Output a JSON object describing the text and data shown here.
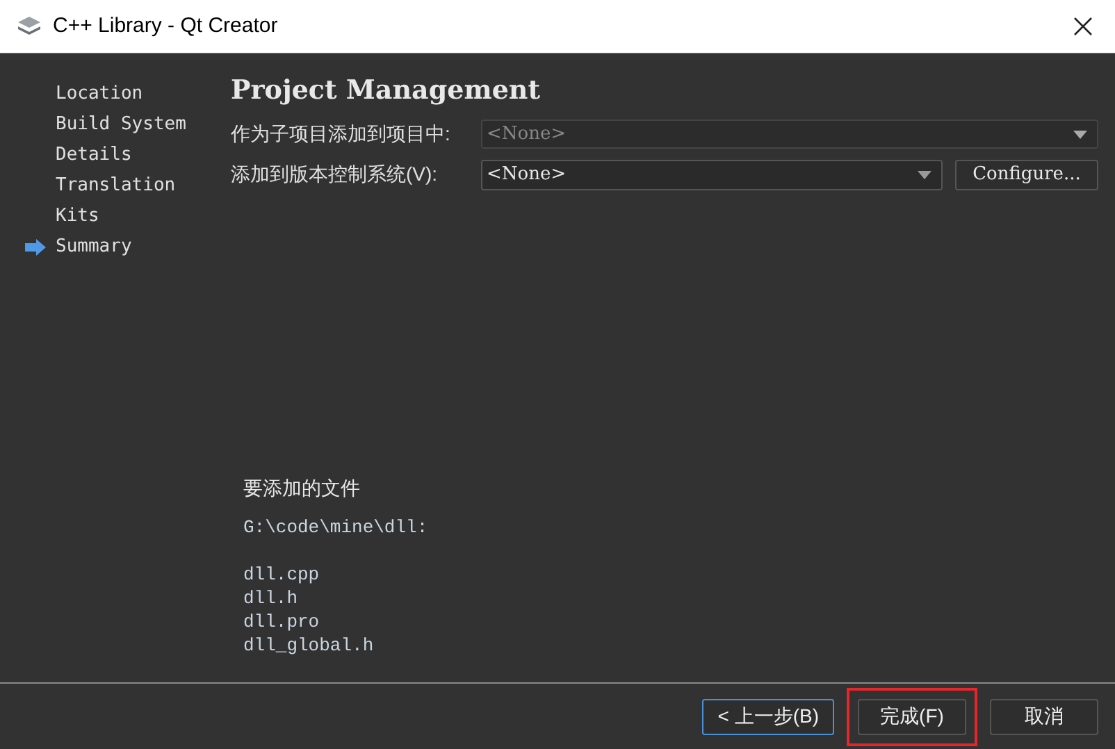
{
  "window": {
    "title": "C++ Library - Qt Creator"
  },
  "steps": [
    {
      "label": "Location",
      "selected": false
    },
    {
      "label": "Build System",
      "selected": false
    },
    {
      "label": "Details",
      "selected": false
    },
    {
      "label": "Translation",
      "selected": false
    },
    {
      "label": "Kits",
      "selected": false
    },
    {
      "label": "Summary",
      "selected": true
    }
  ],
  "page": {
    "title": "Project Management",
    "fields": [
      {
        "label": "作为子项目添加到项目中:",
        "value": "<None>",
        "disabled": true
      },
      {
        "label": "添加到版本控制系统(V):",
        "value": "<None>",
        "disabled": false,
        "button": "Configure..."
      }
    ],
    "files_heading": "要添加的文件",
    "files_path": "G:\\code\\mine\\dll:",
    "files": [
      "dll.cpp",
      "dll.h",
      "dll.pro",
      "dll_global.h"
    ]
  },
  "buttons": [
    {
      "label": "< 上一步(B)",
      "focused": true,
      "highlighted": false
    },
    {
      "label": "完成(F)",
      "focused": false,
      "highlighted": true
    },
    {
      "label": "取消",
      "focused": false,
      "highlighted": false
    }
  ]
}
